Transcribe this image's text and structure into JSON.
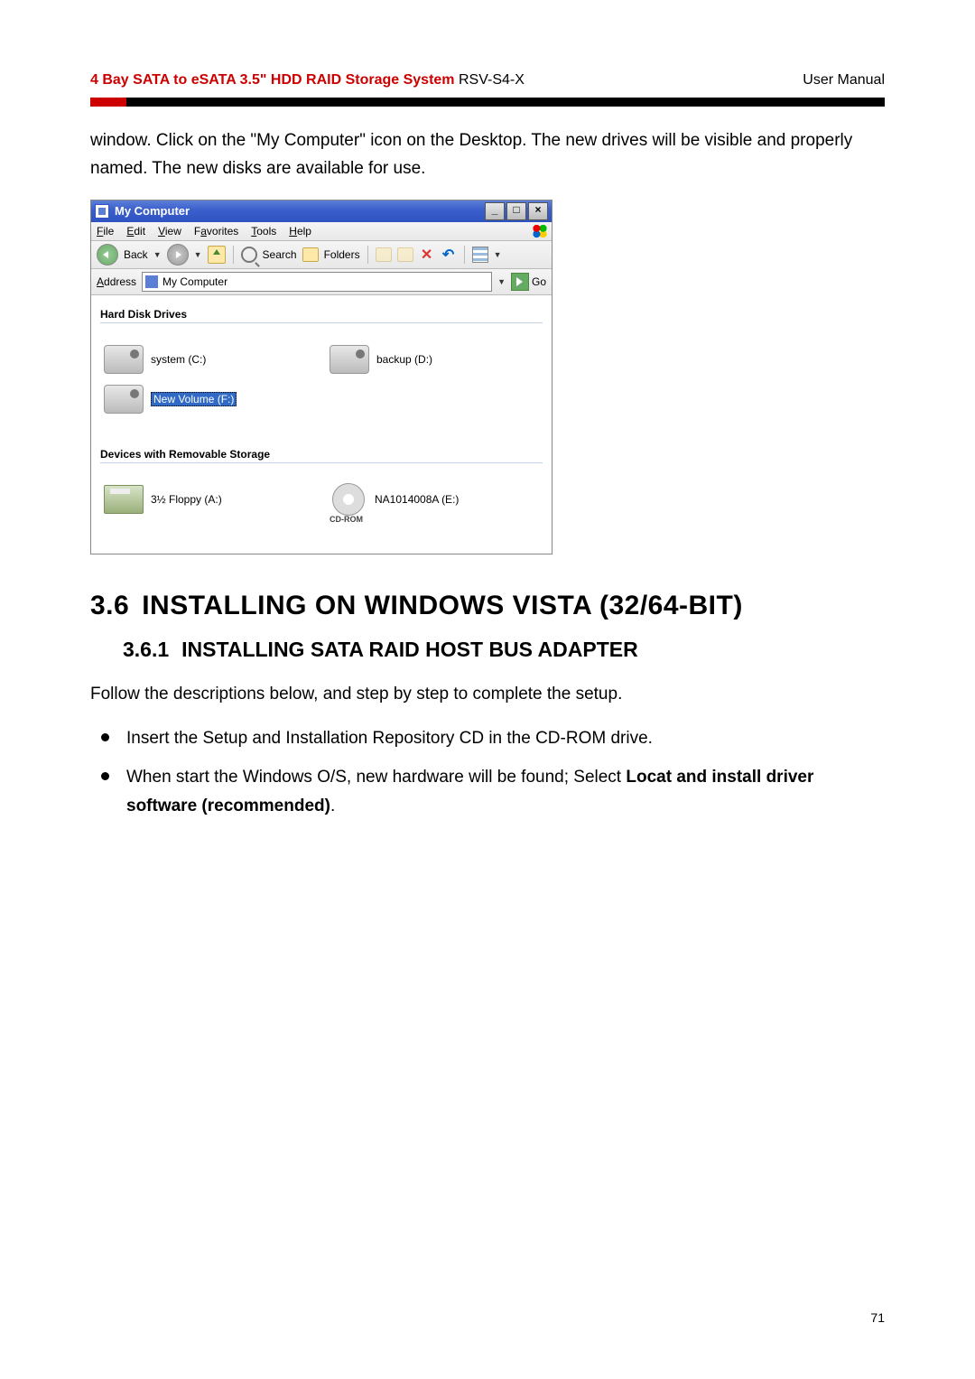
{
  "header": {
    "title_bold": "4 Bay SATA to eSATA 3.5\" HDD RAID Storage System",
    "title_model": "RSV-S4-X",
    "right": "User Manual"
  },
  "intro_text": "window. Click on the \"My Computer\" icon on the Desktop. The new drives will be visible and properly named. The new disks are available for use.",
  "xp": {
    "title": "My Computer",
    "menus": {
      "file": "File",
      "edit": "Edit",
      "view": "View",
      "favorites": "Favorites",
      "tools": "Tools",
      "help": "Help"
    },
    "toolbar": {
      "back": "Back",
      "search": "Search",
      "folders": "Folders"
    },
    "address_label": "Address",
    "address_value": "My Computer",
    "go": "Go",
    "group1": "Hard Disk Drives",
    "drives": {
      "c": "system (C:)",
      "d": "backup (D:)",
      "f": "New Volume (F:)"
    },
    "group2": "Devices with Removable Storage",
    "removable": {
      "a": "3½ Floppy (A:)",
      "e": "NA1014008A (E:)",
      "cdrom_tag": "CD-ROM"
    }
  },
  "section": {
    "num": "3.6",
    "title": "INSTALLING ON WINDOWS VISTA (32/64-BIT)"
  },
  "subsection": {
    "num": "3.6.1",
    "title": "INSTALLING SATA RAID HOST BUS ADAPTER"
  },
  "para_follow": "Follow the descriptions below, and step by step to complete the setup.",
  "bullets": {
    "b1": "Insert the Setup and Installation Repository CD in the CD-ROM drive.",
    "b2_pre": "When start the Windows O/S, new hardware will be found; Select ",
    "b2_bold": "Locat and install driver software (recommended)",
    "b2_post": "."
  },
  "page_number": "71"
}
